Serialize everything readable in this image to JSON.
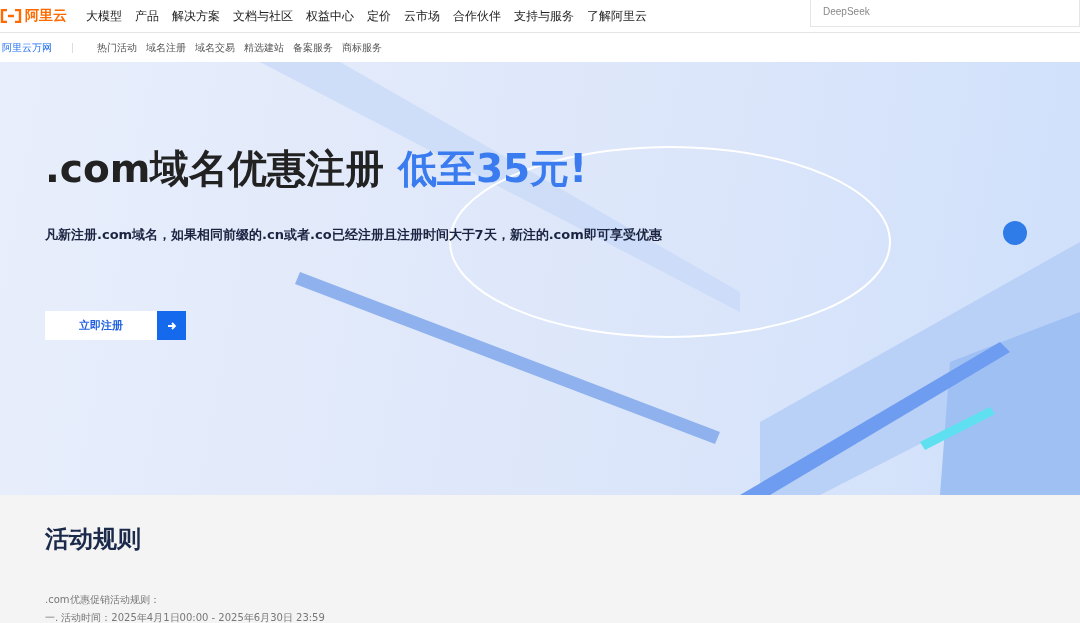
{
  "header": {
    "logo": "阿里云",
    "nav": [
      "大模型",
      "产品",
      "解决方案",
      "文档与社区",
      "权益中心",
      "定价",
      "云市场",
      "合作伙伴",
      "支持与服务",
      "了解阿里云"
    ],
    "search": {
      "placeholder": "DeepSeek"
    }
  },
  "subnav": {
    "brand": "阿里云万网",
    "items": [
      "热门活动",
      "域名注册",
      "域名交易",
      "精选建站",
      "备案服务",
      "商标服务"
    ]
  },
  "hero": {
    "title": ".com域名优惠注册",
    "highlight": "低至35元!",
    "subtitle": "凡新注册.com域名，如果相同前缀的.cn或者.co已经注册且注册时间大于7天，新注的.com即可享受优惠",
    "button": "立即注册"
  },
  "rules": {
    "heading": "活动规则",
    "lines": [
      ".com优惠促销活动规则：",
      "一. 活动时间：2025年4月1日00:00 - 2025年6月30日 23:59"
    ]
  }
}
